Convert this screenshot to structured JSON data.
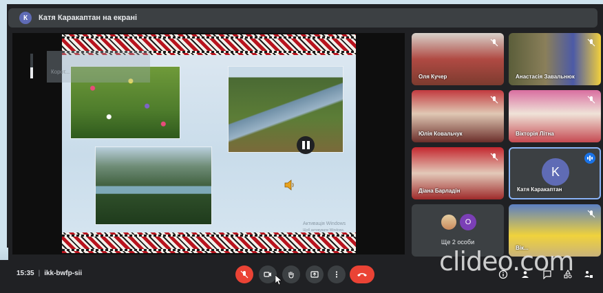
{
  "presenting_banner": {
    "avatar_letter": "К",
    "text": "Катя Каракаптан на екрані"
  },
  "presentation": {
    "overlay_label": "Корот...",
    "activation_title": "Активація Windows",
    "activation_subtitle": "Щоб активувати Windows, перейдіть до розділу «Настройки» комп'ютера."
  },
  "participants": [
    {
      "name": "Оля Кучер",
      "muted": true
    },
    {
      "name": "Анастасія Завальнюк",
      "muted": true
    },
    {
      "name": "Юлія Ковальчук",
      "muted": true
    },
    {
      "name": "Вікторія Літна",
      "muted": true
    },
    {
      "name": "Діана Барладін",
      "muted": true
    },
    {
      "name": "Катя Каракаптан",
      "avatar_letter": "K",
      "speaking": true
    },
    {
      "name": "Вік...",
      "muted": true
    }
  ],
  "more_people": {
    "label": "Ще 2 особи",
    "avatar_letter": "O"
  },
  "meeting": {
    "time": "15:35",
    "code": "ikk-bwfp-sii"
  },
  "controls": {
    "mic": "mic-off-icon",
    "camera": "camera-icon",
    "raise_hand": "hand-icon",
    "present": "present-icon",
    "more": "more-vert-icon",
    "end_call": "end-call-icon"
  },
  "watermark": "clideo.com",
  "colors": {
    "end_call": "#ea4335",
    "speaking": "#1a73e8",
    "avatar": "#5f6bb5"
  }
}
